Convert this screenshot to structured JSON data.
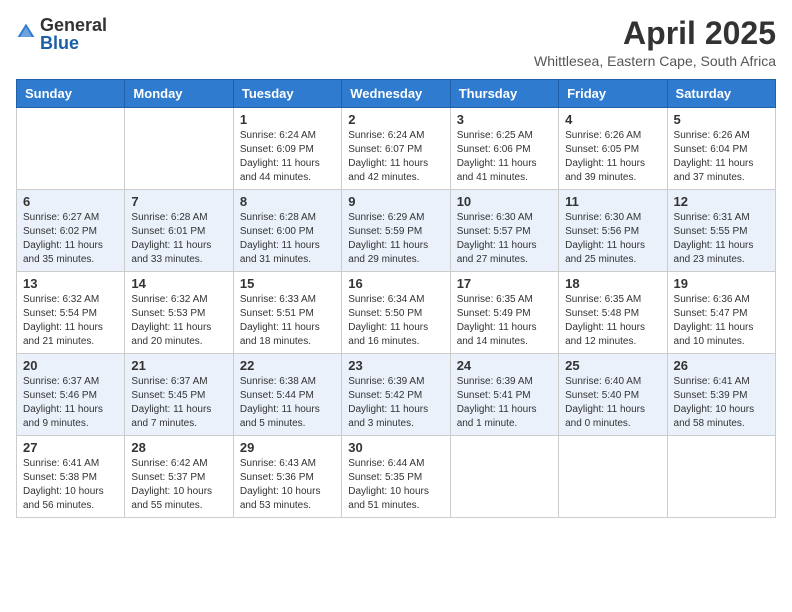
{
  "header": {
    "logo_general": "General",
    "logo_blue": "Blue",
    "month_title": "April 2025",
    "subtitle": "Whittlesea, Eastern Cape, South Africa"
  },
  "weekdays": [
    "Sunday",
    "Monday",
    "Tuesday",
    "Wednesday",
    "Thursday",
    "Friday",
    "Saturday"
  ],
  "weeks": [
    [
      {
        "day": "",
        "sunrise": "",
        "sunset": "",
        "daylight": ""
      },
      {
        "day": "",
        "sunrise": "",
        "sunset": "",
        "daylight": ""
      },
      {
        "day": "1",
        "sunrise": "Sunrise: 6:24 AM",
        "sunset": "Sunset: 6:09 PM",
        "daylight": "Daylight: 11 hours and 44 minutes."
      },
      {
        "day": "2",
        "sunrise": "Sunrise: 6:24 AM",
        "sunset": "Sunset: 6:07 PM",
        "daylight": "Daylight: 11 hours and 42 minutes."
      },
      {
        "day": "3",
        "sunrise": "Sunrise: 6:25 AM",
        "sunset": "Sunset: 6:06 PM",
        "daylight": "Daylight: 11 hours and 41 minutes."
      },
      {
        "day": "4",
        "sunrise": "Sunrise: 6:26 AM",
        "sunset": "Sunset: 6:05 PM",
        "daylight": "Daylight: 11 hours and 39 minutes."
      },
      {
        "day": "5",
        "sunrise": "Sunrise: 6:26 AM",
        "sunset": "Sunset: 6:04 PM",
        "daylight": "Daylight: 11 hours and 37 minutes."
      }
    ],
    [
      {
        "day": "6",
        "sunrise": "Sunrise: 6:27 AM",
        "sunset": "Sunset: 6:02 PM",
        "daylight": "Daylight: 11 hours and 35 minutes."
      },
      {
        "day": "7",
        "sunrise": "Sunrise: 6:28 AM",
        "sunset": "Sunset: 6:01 PM",
        "daylight": "Daylight: 11 hours and 33 minutes."
      },
      {
        "day": "8",
        "sunrise": "Sunrise: 6:28 AM",
        "sunset": "Sunset: 6:00 PM",
        "daylight": "Daylight: 11 hours and 31 minutes."
      },
      {
        "day": "9",
        "sunrise": "Sunrise: 6:29 AM",
        "sunset": "Sunset: 5:59 PM",
        "daylight": "Daylight: 11 hours and 29 minutes."
      },
      {
        "day": "10",
        "sunrise": "Sunrise: 6:30 AM",
        "sunset": "Sunset: 5:57 PM",
        "daylight": "Daylight: 11 hours and 27 minutes."
      },
      {
        "day": "11",
        "sunrise": "Sunrise: 6:30 AM",
        "sunset": "Sunset: 5:56 PM",
        "daylight": "Daylight: 11 hours and 25 minutes."
      },
      {
        "day": "12",
        "sunrise": "Sunrise: 6:31 AM",
        "sunset": "Sunset: 5:55 PM",
        "daylight": "Daylight: 11 hours and 23 minutes."
      }
    ],
    [
      {
        "day": "13",
        "sunrise": "Sunrise: 6:32 AM",
        "sunset": "Sunset: 5:54 PM",
        "daylight": "Daylight: 11 hours and 21 minutes."
      },
      {
        "day": "14",
        "sunrise": "Sunrise: 6:32 AM",
        "sunset": "Sunset: 5:53 PM",
        "daylight": "Daylight: 11 hours and 20 minutes."
      },
      {
        "day": "15",
        "sunrise": "Sunrise: 6:33 AM",
        "sunset": "Sunset: 5:51 PM",
        "daylight": "Daylight: 11 hours and 18 minutes."
      },
      {
        "day": "16",
        "sunrise": "Sunrise: 6:34 AM",
        "sunset": "Sunset: 5:50 PM",
        "daylight": "Daylight: 11 hours and 16 minutes."
      },
      {
        "day": "17",
        "sunrise": "Sunrise: 6:35 AM",
        "sunset": "Sunset: 5:49 PM",
        "daylight": "Daylight: 11 hours and 14 minutes."
      },
      {
        "day": "18",
        "sunrise": "Sunrise: 6:35 AM",
        "sunset": "Sunset: 5:48 PM",
        "daylight": "Daylight: 11 hours and 12 minutes."
      },
      {
        "day": "19",
        "sunrise": "Sunrise: 6:36 AM",
        "sunset": "Sunset: 5:47 PM",
        "daylight": "Daylight: 11 hours and 10 minutes."
      }
    ],
    [
      {
        "day": "20",
        "sunrise": "Sunrise: 6:37 AM",
        "sunset": "Sunset: 5:46 PM",
        "daylight": "Daylight: 11 hours and 9 minutes."
      },
      {
        "day": "21",
        "sunrise": "Sunrise: 6:37 AM",
        "sunset": "Sunset: 5:45 PM",
        "daylight": "Daylight: 11 hours and 7 minutes."
      },
      {
        "day": "22",
        "sunrise": "Sunrise: 6:38 AM",
        "sunset": "Sunset: 5:44 PM",
        "daylight": "Daylight: 11 hours and 5 minutes."
      },
      {
        "day": "23",
        "sunrise": "Sunrise: 6:39 AM",
        "sunset": "Sunset: 5:42 PM",
        "daylight": "Daylight: 11 hours and 3 minutes."
      },
      {
        "day": "24",
        "sunrise": "Sunrise: 6:39 AM",
        "sunset": "Sunset: 5:41 PM",
        "daylight": "Daylight: 11 hours and 1 minute."
      },
      {
        "day": "25",
        "sunrise": "Sunrise: 6:40 AM",
        "sunset": "Sunset: 5:40 PM",
        "daylight": "Daylight: 11 hours and 0 minutes."
      },
      {
        "day": "26",
        "sunrise": "Sunrise: 6:41 AM",
        "sunset": "Sunset: 5:39 PM",
        "daylight": "Daylight: 10 hours and 58 minutes."
      }
    ],
    [
      {
        "day": "27",
        "sunrise": "Sunrise: 6:41 AM",
        "sunset": "Sunset: 5:38 PM",
        "daylight": "Daylight: 10 hours and 56 minutes."
      },
      {
        "day": "28",
        "sunrise": "Sunrise: 6:42 AM",
        "sunset": "Sunset: 5:37 PM",
        "daylight": "Daylight: 10 hours and 55 minutes."
      },
      {
        "day": "29",
        "sunrise": "Sunrise: 6:43 AM",
        "sunset": "Sunset: 5:36 PM",
        "daylight": "Daylight: 10 hours and 53 minutes."
      },
      {
        "day": "30",
        "sunrise": "Sunrise: 6:44 AM",
        "sunset": "Sunset: 5:35 PM",
        "daylight": "Daylight: 10 hours and 51 minutes."
      },
      {
        "day": "",
        "sunrise": "",
        "sunset": "",
        "daylight": ""
      },
      {
        "day": "",
        "sunrise": "",
        "sunset": "",
        "daylight": ""
      },
      {
        "day": "",
        "sunrise": "",
        "sunset": "",
        "daylight": ""
      }
    ]
  ]
}
